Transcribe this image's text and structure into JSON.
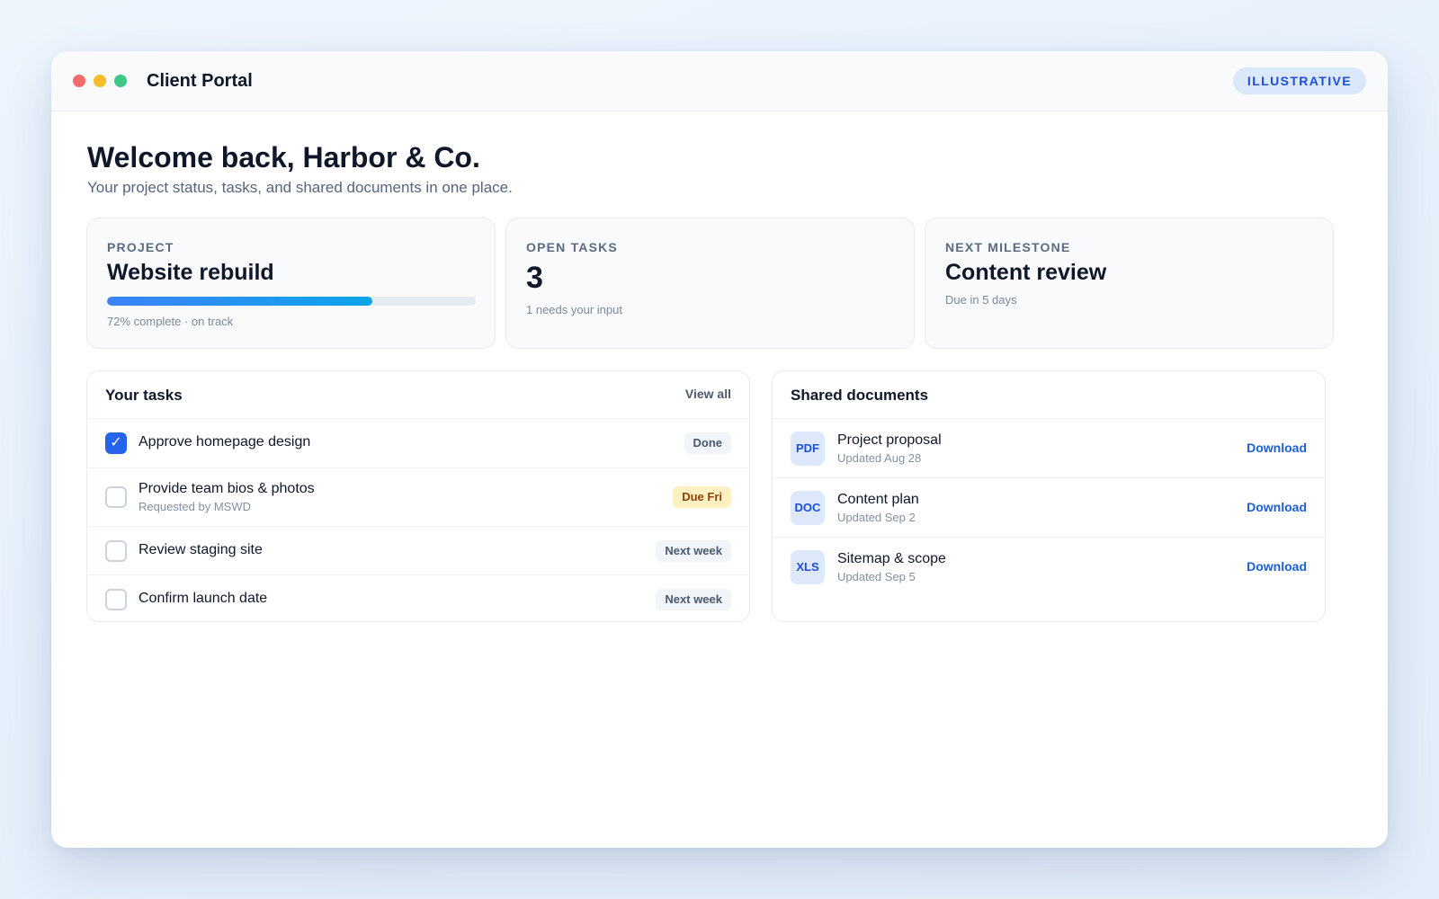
{
  "window": {
    "title": "Client Portal",
    "badge": "ILLUSTRATIVE"
  },
  "welcome": {
    "heading": "Welcome back, Harbor & Co.",
    "subtitle": "Your project status, tasks, and shared documents in one place."
  },
  "stats": {
    "project": {
      "label": "PROJECT",
      "value": "Website rebuild",
      "progress_percent": 72,
      "note": "72% complete · on track"
    },
    "open_tasks": {
      "label": "OPEN TASKS",
      "value": "3",
      "note": "1 needs your input"
    },
    "milestone": {
      "label": "NEXT MILESTONE",
      "value": "Content review",
      "note": "Due in 5 days"
    }
  },
  "tasks": {
    "title": "Your tasks",
    "view_all": "View all",
    "items": [
      {
        "title": "Approve homepage design",
        "sub": "",
        "checked": true,
        "status": "Done",
        "status_style": "neutral"
      },
      {
        "title": "Provide team bios & photos",
        "sub": "Requested by MSWD",
        "checked": false,
        "status": "Due Fri",
        "status_style": "warn"
      },
      {
        "title": "Review staging site",
        "sub": "",
        "checked": false,
        "status": "Next week",
        "status_style": "neutral"
      },
      {
        "title": "Confirm launch date",
        "sub": "",
        "checked": false,
        "status": "Next week",
        "status_style": "neutral"
      }
    ]
  },
  "documents": {
    "title": "Shared documents",
    "action_label": "Download",
    "items": [
      {
        "type": "PDF",
        "name": "Project proposal",
        "updated": "Updated Aug 28"
      },
      {
        "type": "DOC",
        "name": "Content plan",
        "updated": "Updated Sep 2"
      },
      {
        "type": "XLS",
        "name": "Sitemap & scope",
        "updated": "Updated Sep 5"
      }
    ]
  },
  "colors": {
    "accent": "#2563eb",
    "link": "#1d5fd8",
    "warn_bg": "#fdf1c2",
    "warn_text": "#92400e",
    "window_dot_red": "#f36b6b",
    "window_dot_yellow": "#f5bd2c",
    "window_dot_green": "#3cc98a"
  }
}
